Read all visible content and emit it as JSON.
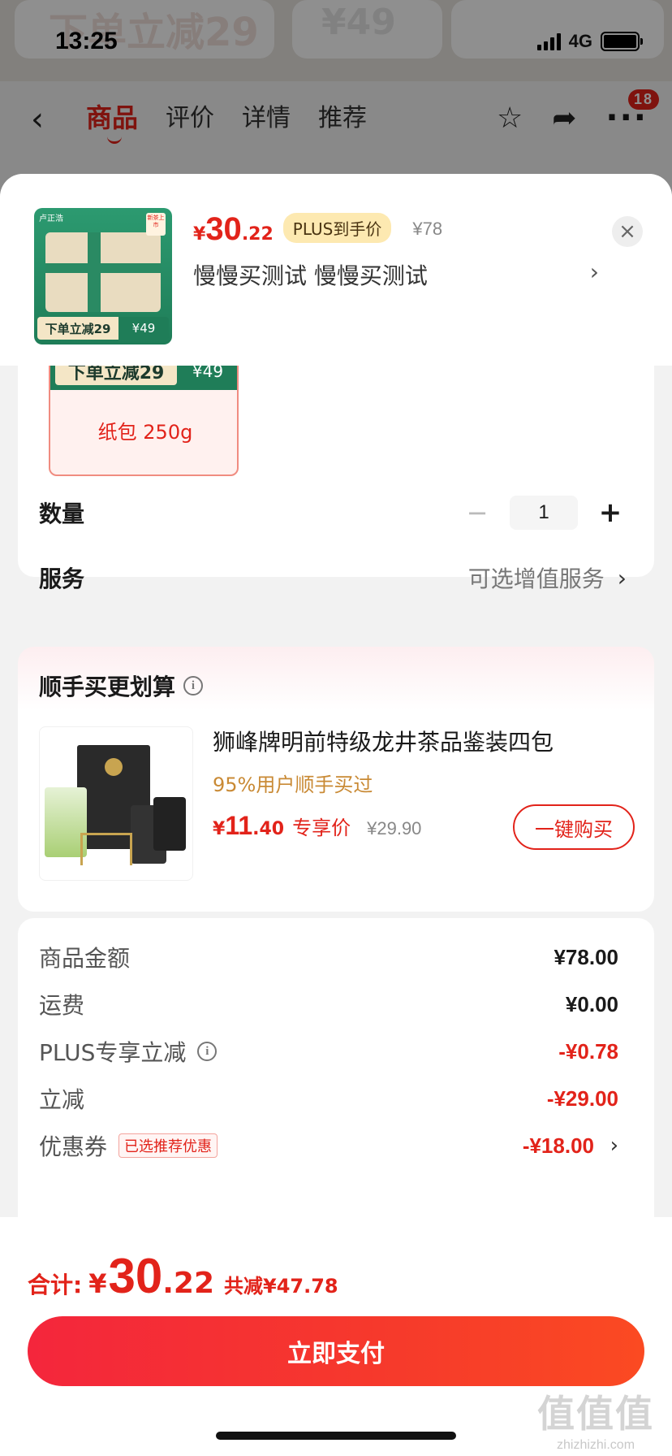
{
  "status_bar": {
    "time": "13:25",
    "network": "4G"
  },
  "background_page": {
    "banner_left": "下单立减29",
    "banner_right": "¥49",
    "nav_tabs": [
      "商品",
      "评价",
      "详情",
      "推荐"
    ],
    "cart_badge": "18",
    "back_glyph": "‹",
    "star_glyph": "☆",
    "share_glyph": "➦",
    "more_glyph": "···"
  },
  "sheet_header": {
    "price_currency": "¥",
    "price_int": "30",
    "price_dec": ".22",
    "plus_label": "PLUS到手价",
    "original_price": "¥78",
    "selected_spec": "慢慢买测试  慢慢买测试",
    "spec_arrow": "›",
    "close_glyph": "×",
    "thumb_brand": "卢正浩",
    "thumb_promo_left": "下单立减29",
    "thumb_promo_right": "¥49",
    "thumb_tag": "新茶上市"
  },
  "variant": {
    "promo_left": "下单立减29",
    "promo_right": "¥49",
    "label": "纸包 250g"
  },
  "quantity": {
    "label": "数量",
    "minus": "−",
    "value": "1",
    "plus": "+"
  },
  "service": {
    "label": "服务",
    "value": "可选增值服务",
    "arrow": "›"
  },
  "bundle": {
    "title": "顺手买更划算",
    "info_glyph": "i",
    "product_name": "狮峰牌明前特级龙井茶品鉴装四包",
    "buyers_text": "95%用户顺手买过",
    "price_currency": "¥",
    "price_int": "11",
    "price_dec": ".40",
    "price_label": "专享价",
    "original_price": "¥29.90",
    "buy_button": "一键购买"
  },
  "summary": {
    "rows": [
      {
        "label": "商品金额",
        "value": "¥78.00"
      },
      {
        "label": "运费",
        "value": "¥0.00"
      },
      {
        "label": "PLUS专享立减",
        "value": "-¥0.78"
      },
      {
        "label": "立减",
        "value": "-¥29.00"
      },
      {
        "label": "优惠券",
        "value": "-¥18.00",
        "tag": "已选推荐优惠"
      }
    ],
    "info_glyph": "i",
    "arrow": "›"
  },
  "footer": {
    "total_label": "合计:",
    "total_currency": "¥",
    "total_int": "30",
    "total_dec": ".22",
    "total_saved": "共减¥47.78",
    "pay_button": "立即支付"
  },
  "watermark": {
    "big": "值值值",
    "small": "zhizhizhi.com"
  },
  "colors": {
    "accent_red": "#e2231a",
    "plus_badge_bg": "#fde9b1",
    "buyers_text": "#c98a35",
    "pay_gradient_start": "#f4263c",
    "pay_gradient_end": "#fb4a22"
  }
}
